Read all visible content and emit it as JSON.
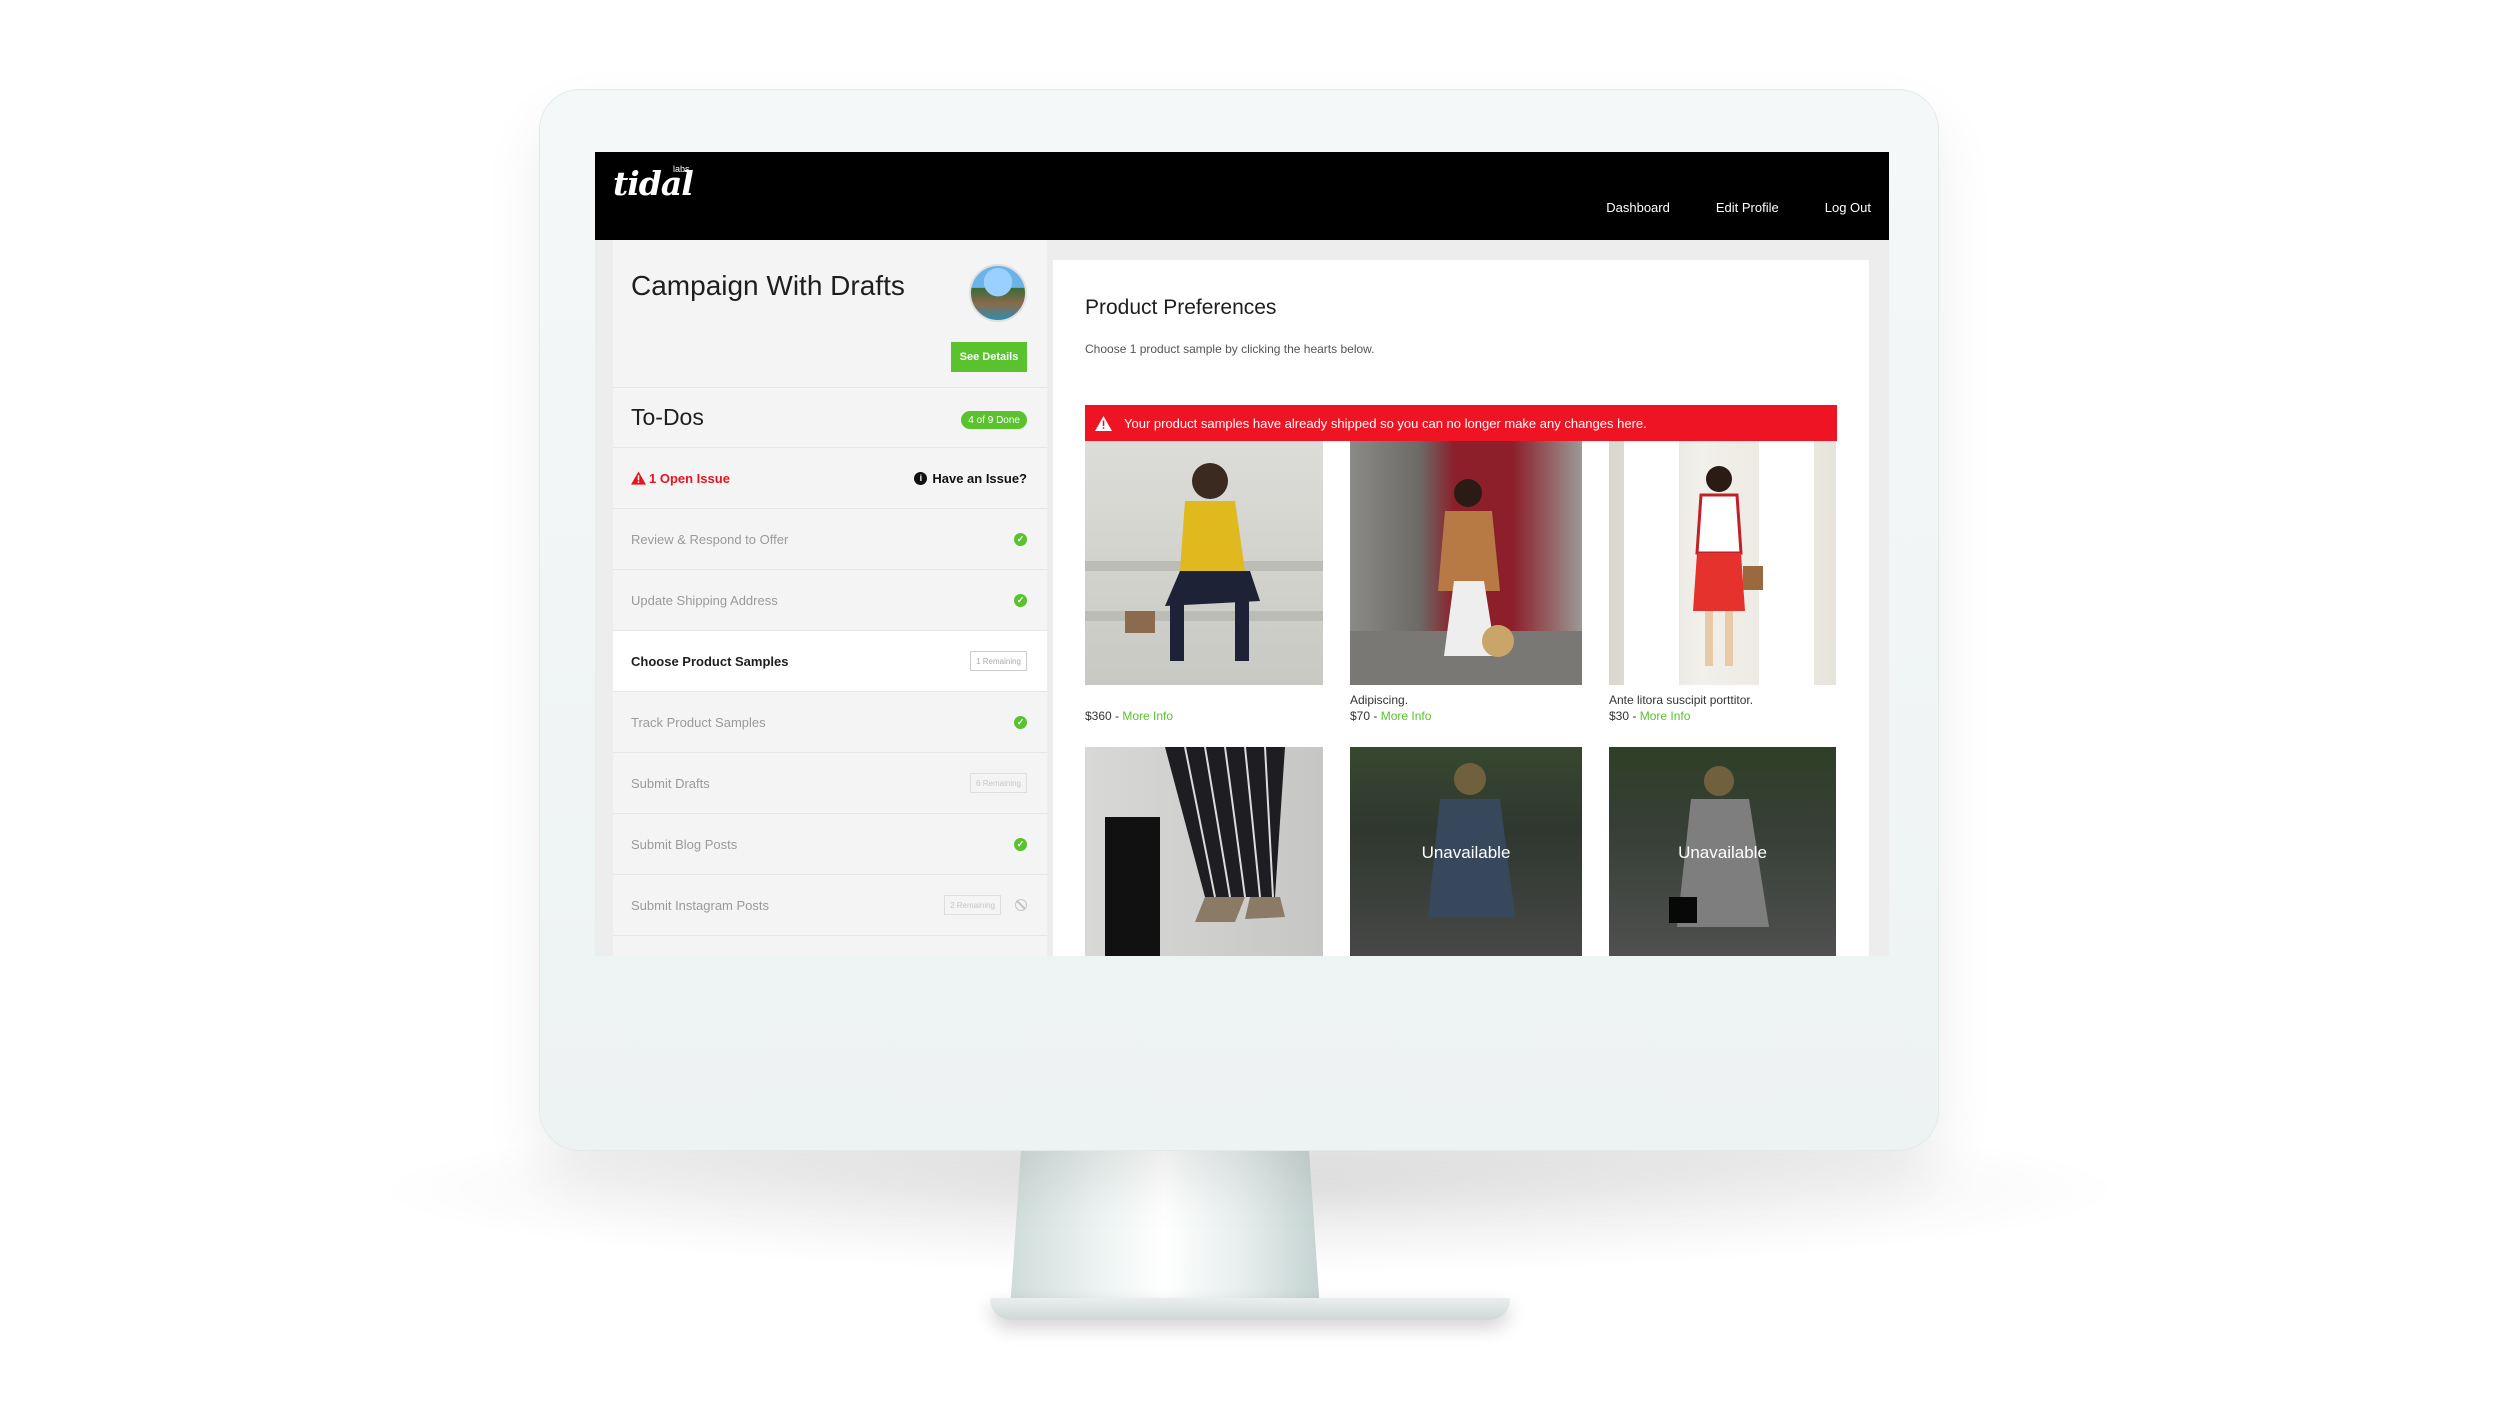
{
  "app": {
    "logo_text": "tidal",
    "logo_sub": "labs"
  },
  "nav": {
    "items": [
      {
        "label": "Dashboard"
      },
      {
        "label": "Edit Profile"
      },
      {
        "label": "Log Out"
      }
    ]
  },
  "sidebar": {
    "campaign_title": "Campaign With Drafts",
    "see_details_label": "See Details",
    "todos_title": "To-Dos",
    "done_badge": "4 of 9 Done",
    "open_issue": "1 Open Issue",
    "have_issue": "Have an Issue?",
    "tasks": [
      {
        "label": "Review & Respond to Offer",
        "status": "done"
      },
      {
        "label": "Update Shipping Address",
        "status": "done"
      },
      {
        "label": "Choose Product Samples",
        "status": "remaining",
        "remaining": "1 Remaining"
      },
      {
        "label": "Track Product Samples",
        "status": "done"
      },
      {
        "label": "Submit Drafts",
        "status": "remaining",
        "remaining": "6 Remaining"
      },
      {
        "label": "Submit Blog Posts",
        "status": "done"
      },
      {
        "label": "Submit Instagram Posts",
        "status": "blocked",
        "remaining": "2 Remaining"
      }
    ]
  },
  "main": {
    "title": "Product Preferences",
    "subtitle": "Choose 1 product sample by clicking the hearts below.",
    "alert": "Your product samples have already shipped so you can no longer make any changes here.",
    "more_info_label": "More Info",
    "products": [
      {
        "name": "",
        "price": "$360",
        "available": true
      },
      {
        "name": "Adipiscing.",
        "price": "$70",
        "available": true
      },
      {
        "name": "Ante litora suscipit porttitor.",
        "price": "$30",
        "available": true
      },
      {
        "name": "",
        "price": "",
        "available": true
      },
      {
        "name": "",
        "price": "",
        "available": false,
        "overlay": "Unavailable"
      },
      {
        "name": "",
        "price": "",
        "available": false,
        "overlay": "Unavailable"
      }
    ]
  },
  "colors": {
    "accent_green": "#59c22d",
    "alert_red": "#ee1423",
    "topbar": "#000000"
  }
}
